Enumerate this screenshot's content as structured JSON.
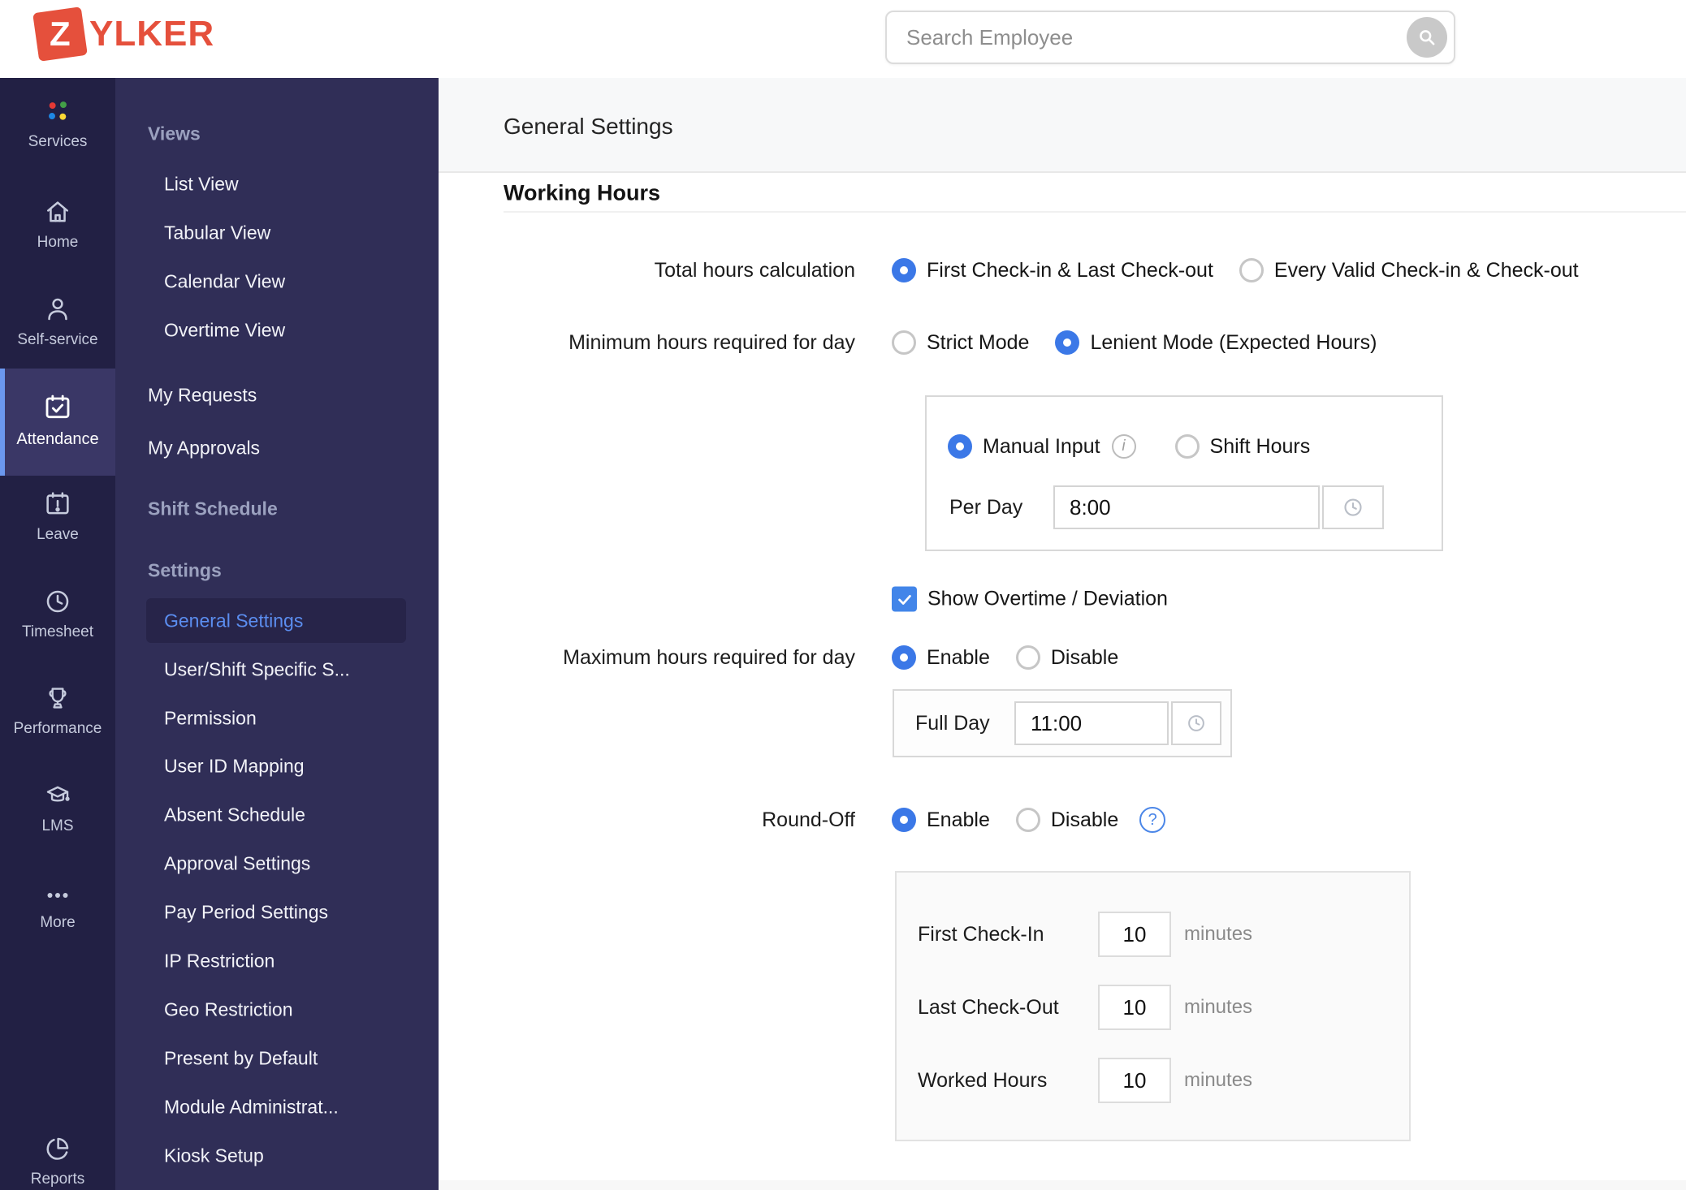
{
  "colors": {
    "accent_blue": "#3b78e7",
    "brand_red": "#e5503c",
    "rail_bg": "#222044",
    "sidebar_bg": "#302e57",
    "active_link_blue": "#5b8def"
  },
  "header": {
    "logo_z": "Z",
    "logo_rest": "YLKER",
    "search": {
      "placeholder": "Search Employee"
    }
  },
  "rail": {
    "items": [
      {
        "id": "services",
        "label": "Services"
      },
      {
        "id": "home",
        "label": "Home"
      },
      {
        "id": "self-service",
        "label": "Self-service"
      },
      {
        "id": "attendance",
        "label": "Attendance",
        "active": true
      },
      {
        "id": "leave",
        "label": "Leave"
      },
      {
        "id": "timesheet",
        "label": "Timesheet"
      },
      {
        "id": "performance",
        "label": "Performance"
      },
      {
        "id": "lms",
        "label": "LMS"
      },
      {
        "id": "more",
        "label": "More"
      },
      {
        "id": "reports",
        "label": "Reports"
      }
    ]
  },
  "sidebar": {
    "views_header": "Views",
    "views_items": [
      "List View",
      "Tabular View",
      "Calendar View",
      "Overtime View"
    ],
    "top_items": [
      "My Requests",
      "My Approvals"
    ],
    "shift_schedule_header": "Shift Schedule",
    "settings_header": "Settings",
    "settings_items": [
      "General Settings",
      "User/Shift Specific S...",
      "Permission",
      "User ID Mapping",
      "Absent Schedule",
      "Approval Settings",
      "Pay Period Settings",
      "IP Restriction",
      "Geo Restriction",
      "Present by Default",
      "Module Administrat...",
      "Kiosk Setup"
    ],
    "active_item": "General Settings"
  },
  "main": {
    "page_title": "General Settings",
    "section_title": "Working Hours",
    "total_hours": {
      "label": "Total hours calculation",
      "options": [
        {
          "label": "First Check-in & Last Check-out",
          "selected": true
        },
        {
          "label": "Every Valid Check-in & Check-out",
          "selected": false
        }
      ]
    },
    "min_hours": {
      "label": "Minimum hours required for day",
      "options": [
        {
          "label": "Strict Mode",
          "selected": false
        },
        {
          "label": "Lenient Mode (Expected Hours)",
          "selected": true
        }
      ]
    },
    "input_mode": {
      "options": [
        {
          "label": "Manual Input",
          "selected": true
        },
        {
          "label": "Shift Hours",
          "selected": false
        }
      ],
      "per_day_label": "Per Day",
      "per_day_value": "8:00"
    },
    "show_overtime": {
      "label": "Show Overtime / Deviation",
      "checked": true
    },
    "max_hours": {
      "label": "Maximum hours required for day",
      "options": [
        {
          "label": "Enable",
          "selected": true
        },
        {
          "label": "Disable",
          "selected": false
        }
      ],
      "full_day_label": "Full Day",
      "full_day_value": "11:00"
    },
    "round_off": {
      "label": "Round-Off",
      "options": [
        {
          "label": "Enable",
          "selected": true
        },
        {
          "label": "Disable",
          "selected": false
        }
      ],
      "rows": [
        {
          "label": "First Check-In",
          "value": "10",
          "unit": "minutes"
        },
        {
          "label": "Last Check-Out",
          "value": "10",
          "unit": "minutes"
        },
        {
          "label": "Worked Hours",
          "value": "10",
          "unit": "minutes"
        }
      ]
    }
  }
}
